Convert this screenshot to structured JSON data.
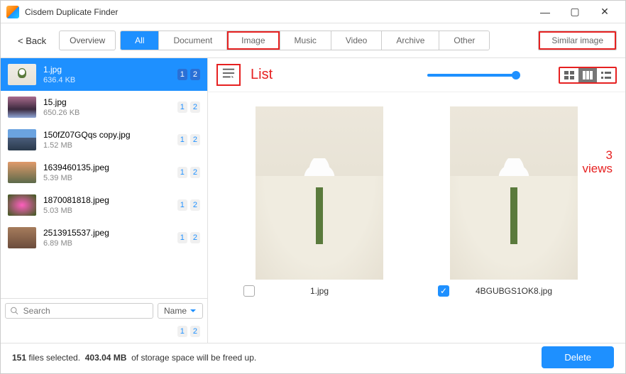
{
  "app": {
    "title": "Cisdem Duplicate Finder"
  },
  "toolbar": {
    "back": "< Back",
    "overview": "Overview",
    "tabs": [
      "All",
      "Document",
      "Image",
      "Music",
      "Video",
      "Archive",
      "Other"
    ],
    "similar": "Similar image"
  },
  "sidebar": {
    "search_placeholder": "Search",
    "sort_label": "Name",
    "items": [
      {
        "name": "1.jpg",
        "size": "636.4 KB",
        "badges": [
          "1",
          "2"
        ],
        "selected": true,
        "thumb": "wedding"
      },
      {
        "name": "15.jpg",
        "size": "650.26 KB",
        "badges": [
          "1",
          "2"
        ],
        "thumb": "landscape"
      },
      {
        "name": "150fZ07GQqs copy.jpg",
        "size": "1.52 MB",
        "badges": [
          "1",
          "2"
        ],
        "thumb": "mountain"
      },
      {
        "name": "1639460135.jpeg",
        "size": "5.39 MB",
        "badges": [
          "1",
          "2"
        ],
        "thumb": "people"
      },
      {
        "name": "1870081818.jpeg",
        "size": "5.03 MB",
        "badges": [
          "1",
          "2"
        ],
        "thumb": "pinkflower"
      },
      {
        "name": "2513915537.jpeg",
        "size": "6.89 MB",
        "badges": [
          "1",
          "2"
        ],
        "thumb": "crowd"
      }
    ],
    "summary_badges": [
      "1",
      "2"
    ]
  },
  "preview": {
    "list_label": "List",
    "views_annotation_line1": "3",
    "views_annotation_line2": "views",
    "items": [
      {
        "name": "1.jpg",
        "checked": false
      },
      {
        "name": "4BGUBGS1OK8.jpg",
        "checked": true
      }
    ]
  },
  "footer": {
    "count": "151",
    "count_suffix": " files selected.  ",
    "size": "403.04 MB",
    "size_suffix": "  of storage space will be freed up.",
    "delete": "Delete"
  }
}
